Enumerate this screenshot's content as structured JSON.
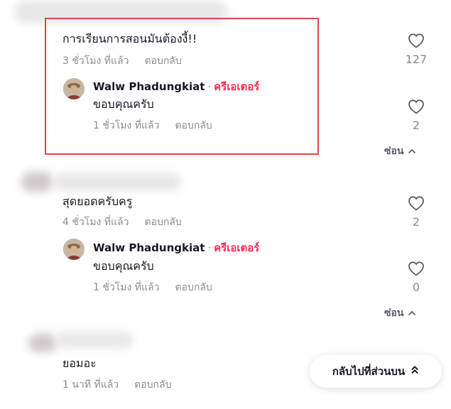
{
  "comments": [
    {
      "text": "การเรียนการสอนมันต้องงี้!!",
      "time": "3 ชั่วโมง ที่แล้ว",
      "reply_label": "ตอบกลับ",
      "likes": "127",
      "reply": {
        "author": "Walw Phadungkiat",
        "separator": "·",
        "badge": "ครีเอเตอร์",
        "text": "ขอบคุณครับ",
        "time": "1 ชั่วโมง ที่แล้ว",
        "reply_label": "ตอบกลับ",
        "likes": "2"
      },
      "collapse_label": "ซ่อน"
    },
    {
      "text": "สุดยอดครับครู",
      "time": "4 ชั่วโมง ที่แล้ว",
      "reply_label": "ตอบกลับ",
      "likes": "2",
      "reply": {
        "author": "Walw Phadungkiat",
        "separator": "·",
        "badge": "ครีเอเตอร์",
        "text": "ขอบคุณครับ",
        "time": "1 ชั่วโมง ที่แล้ว",
        "reply_label": "ตอบกลับ",
        "likes": "0"
      },
      "collapse_label": "ซ่อน"
    },
    {
      "text": "ยอมอะ",
      "time": "1 นาที ที่แล้ว",
      "reply_label": "ตอบกลับ"
    }
  ],
  "back_to_top_label": "กลับไปที่ส่วนบน",
  "colors": {
    "creator_badge": "#fe2c55",
    "highlight_border": "#e04848",
    "meta_text": "#8a8b91"
  },
  "icons": {
    "like": "heart-outline-icon",
    "collapse": "chevron-up-icon",
    "back_to_top": "double-chevron-up-icon"
  }
}
